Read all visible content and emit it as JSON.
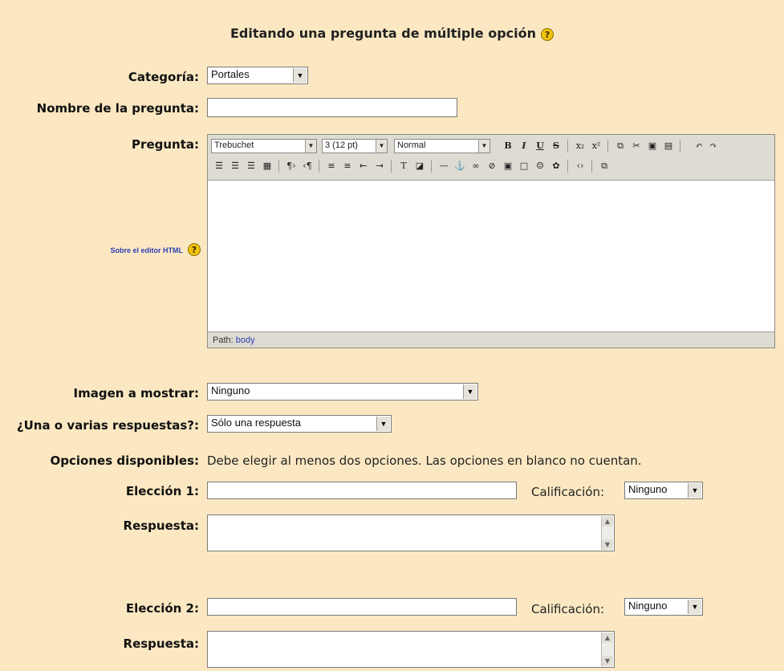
{
  "page": {
    "title": "Editando una pregunta de múltiple opción"
  },
  "form": {
    "category": {
      "label": "Categoría:",
      "value": "Portales"
    },
    "question_name": {
      "label": "Nombre de la pregunta:",
      "value": ""
    },
    "question": {
      "label": "Pregunta:"
    },
    "html_help": {
      "label": "Sobre el editor HTML"
    },
    "image": {
      "label": "Imagen a mostrar:",
      "value": "Ninguno"
    },
    "answers_mode": {
      "label": "¿Una o varias respuestas?:",
      "value": "Sólo una respuesta"
    },
    "options": {
      "label": "Opciones disponibles:",
      "note": "Debe elegir al menos dos opciones. Las opciones en blanco no cuentan."
    },
    "choices": [
      {
        "label": "Elección 1:",
        "value": "",
        "grade_label": "Calificación:",
        "grade_value": "Ninguno",
        "response_label": "Respuesta:"
      },
      {
        "label": "Elección 2:",
        "value": "",
        "grade_label": "Calificación:",
        "grade_value": "Ninguno",
        "response_label": "Respuesta:"
      }
    ]
  },
  "editor": {
    "font": "Trebuchet",
    "size": "3 (12 pt)",
    "format": "Normal",
    "path_label": "Path:",
    "path_value": "body",
    "buttons_row1": [
      "B",
      "I",
      "U",
      "S",
      "x₂",
      "x²",
      "copy",
      "cut",
      "paste",
      "clean",
      "undo",
      "redo"
    ],
    "buttons_row2": [
      "align-left",
      "align-center",
      "align-right",
      "justify",
      "ltr",
      "rtl",
      "ordered-list",
      "unordered-list",
      "outdent",
      "indent",
      "text-color",
      "bg-color",
      "hr",
      "anchor",
      "link",
      "unlink",
      "image",
      "table",
      "smiley",
      "special-char",
      "html-source",
      "fullscreen"
    ]
  },
  "icons": {
    "help": "?"
  }
}
